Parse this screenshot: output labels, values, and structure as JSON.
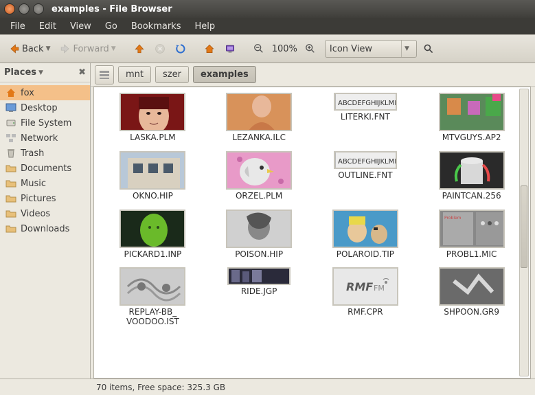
{
  "window": {
    "title": "examples - File Browser"
  },
  "menubar": [
    "File",
    "Edit",
    "View",
    "Go",
    "Bookmarks",
    "Help"
  ],
  "toolbar": {
    "back_label": "Back",
    "forward_label": "Forward",
    "zoom_label": "100%",
    "view_mode": "Icon View"
  },
  "sidebar": {
    "heading": "Places",
    "items": [
      {
        "icon": "folder-home",
        "label": "fox",
        "selected": true
      },
      {
        "icon": "desktop",
        "label": "Desktop"
      },
      {
        "icon": "harddisk",
        "label": "File System"
      },
      {
        "icon": "network",
        "label": "Network"
      },
      {
        "icon": "trash",
        "label": "Trash"
      },
      {
        "icon": "folder",
        "label": "Documents"
      },
      {
        "icon": "folder",
        "label": "Music"
      },
      {
        "icon": "folder",
        "label": "Pictures"
      },
      {
        "icon": "folder",
        "label": "Videos"
      },
      {
        "icon": "folder",
        "label": "Downloads"
      }
    ]
  },
  "pathbar": [
    "mnt",
    "szer",
    "examples"
  ],
  "files": [
    {
      "name": "LASKA.PLM",
      "thumb": "face-red"
    },
    {
      "name": "LEZANKA.ILC",
      "thumb": "person-warm"
    },
    {
      "name": "LITERKI.FNT",
      "thumb": "font-strip",
      "narrow": true
    },
    {
      "name": "MTVGUYS.AP2",
      "thumb": "pixel-color"
    },
    {
      "name": "OKNO.HIP",
      "thumb": "building"
    },
    {
      "name": "ORZEL.PLM",
      "thumb": "eagle-pink"
    },
    {
      "name": "OUTLINE.FNT",
      "thumb": "font-strip",
      "narrow": true
    },
    {
      "name": "PAINTCAN.256",
      "thumb": "paintcan"
    },
    {
      "name": "PICKARD1.INP",
      "thumb": "green-head"
    },
    {
      "name": "POISON.HIP",
      "thumb": "gray-portrait"
    },
    {
      "name": "POLAROID.TIP",
      "thumb": "polaroid"
    },
    {
      "name": "PROBL1.MIC",
      "thumb": "ui-gray"
    },
    {
      "name": "REPLAY-BB_\nVOODOO.IST",
      "thumb": "gray-swirl"
    },
    {
      "name": "RIDE.JGP",
      "thumb": "dark-strip",
      "narrow": true
    },
    {
      "name": "RMF.CPR",
      "thumb": "rmf-logo"
    },
    {
      "name": "SHPOON.GR9",
      "thumb": "gray-logo"
    }
  ],
  "statusbar": "70 items, Free space: 325.3 GB"
}
